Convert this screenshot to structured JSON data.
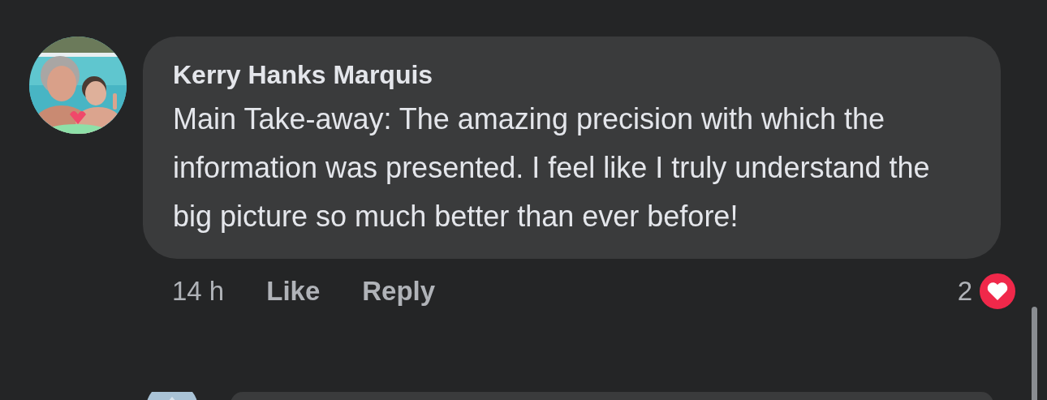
{
  "comment": {
    "author": "Kerry Hanks Marquis",
    "text": "Main Take-away: The amazing precision with which the information was presented. I feel like I truly understand the big picture so much better than ever before!",
    "time": "14 h",
    "actions": [
      "Like",
      "Reply"
    ],
    "reaction_count": "2"
  }
}
